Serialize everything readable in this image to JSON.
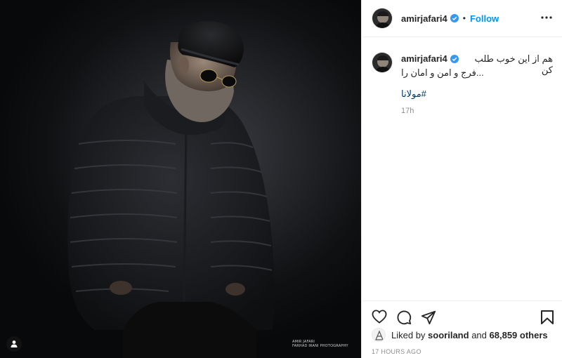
{
  "photo": {
    "credit_line1": "AMIR JAFARI",
    "credit_line2": "FARHAD IRANI PHOTOGRAPHY"
  },
  "header": {
    "username": "amirjafari4",
    "dot": "•",
    "follow_label": "Follow"
  },
  "caption": {
    "username": "amirjafari4",
    "line1": "هم از این خوب طلب کن",
    "line2": "فرج و امن و امان را...",
    "hashtag": "#مولانا",
    "time": "17h"
  },
  "likes": {
    "prefix": "Liked by",
    "user": "sooriland",
    "and": "and",
    "others": "68,859 others"
  },
  "posted_ago": "17 HOURS AGO",
  "icons": {
    "verified": "verified-badge-icon",
    "more": "more-options-icon",
    "like": "heart-icon",
    "comment": "comment-icon",
    "share": "share-icon",
    "save": "bookmark-icon",
    "tag": "user-tag-icon"
  },
  "colors": {
    "accent": "#0095f6",
    "hashtag": "#00376b",
    "secondary_text": "#8e8e8e"
  }
}
